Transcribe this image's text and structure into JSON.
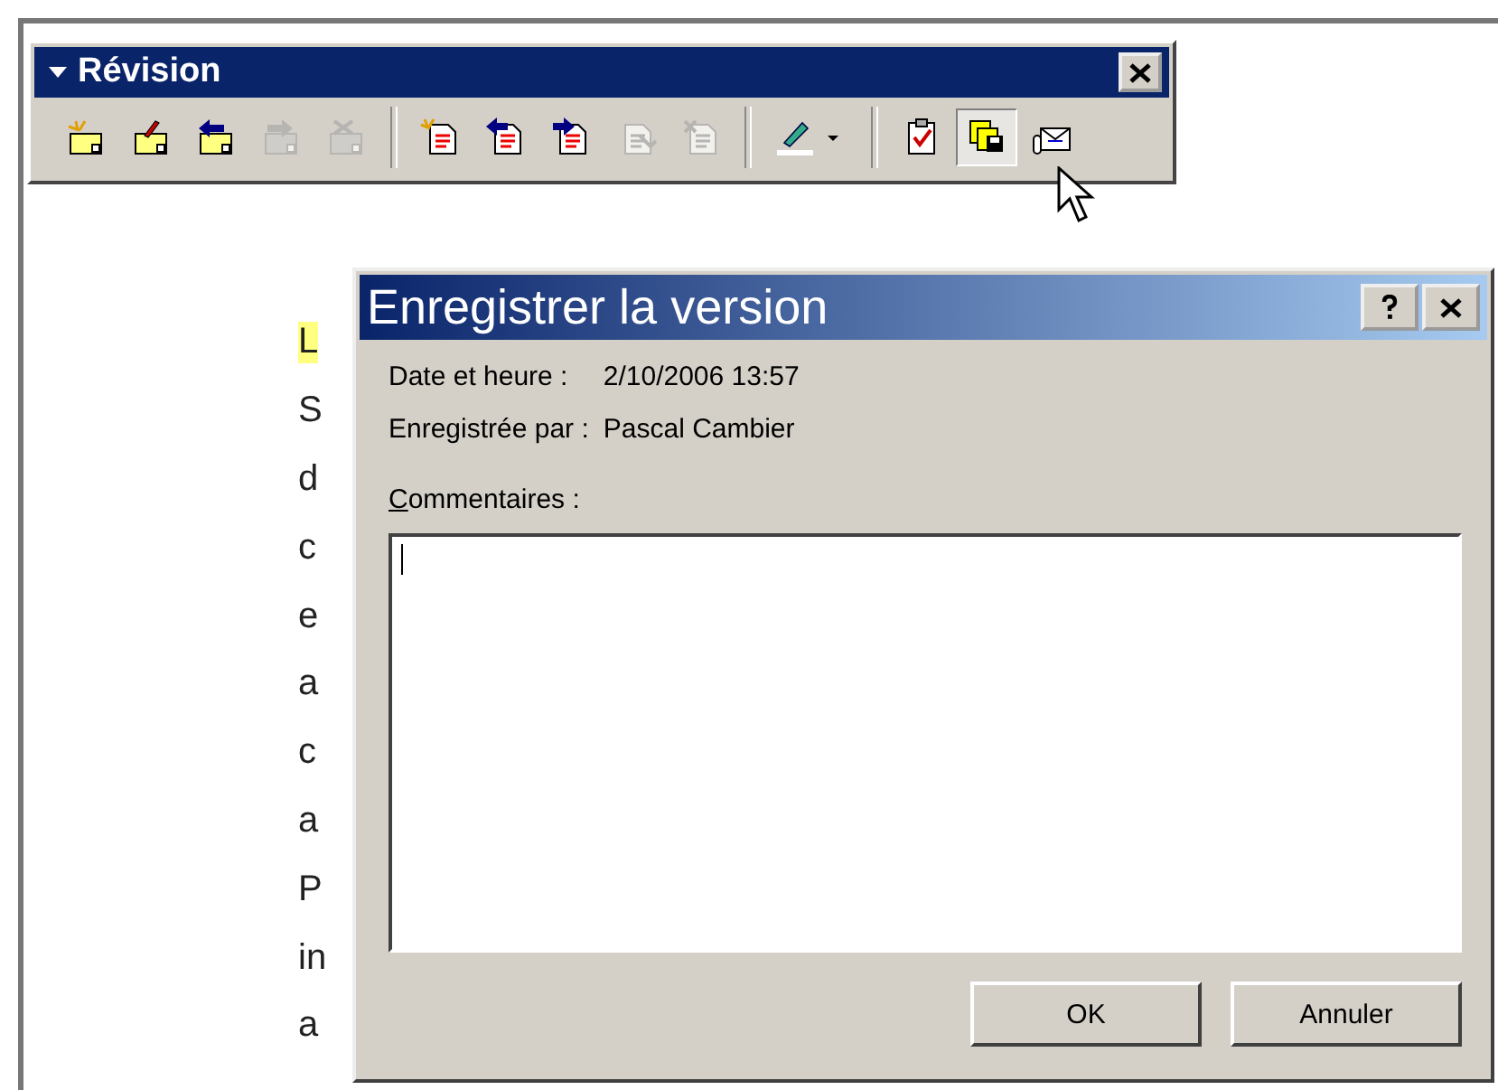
{
  "document": {
    "rows": [
      {
        "text": "L",
        "highlighted": true
      },
      {
        "text": "S",
        "highlighted": false
      },
      {
        "text": "d",
        "highlighted": false
      },
      {
        "text": "c",
        "highlighted": false
      },
      {
        "text": "e",
        "highlighted": false
      },
      {
        "text": "a",
        "highlighted": false
      },
      {
        "text": "c",
        "highlighted": false
      },
      {
        "text": "a",
        "highlighted": false
      },
      {
        "text": "P",
        "highlighted": false
      },
      {
        "text": "in",
        "highlighted": false
      },
      {
        "text": "a",
        "highlighted": false
      }
    ]
  },
  "toolbar": {
    "title": "Révision",
    "buttons": [
      {
        "kind": "note-new",
        "disabled": false,
        "pressed": false
      },
      {
        "kind": "note-edit",
        "disabled": false,
        "pressed": false
      },
      {
        "kind": "note-prev",
        "disabled": false,
        "pressed": false
      },
      {
        "kind": "note-next",
        "disabled": true,
        "pressed": false
      },
      {
        "kind": "note-delete",
        "disabled": true,
        "pressed": false
      },
      {
        "kind": "separator"
      },
      {
        "kind": "change-new",
        "disabled": false,
        "pressed": false
      },
      {
        "kind": "change-prev",
        "disabled": false,
        "pressed": false
      },
      {
        "kind": "change-next",
        "disabled": false,
        "pressed": false
      },
      {
        "kind": "change-accept",
        "disabled": true,
        "pressed": false
      },
      {
        "kind": "change-reject",
        "disabled": true,
        "pressed": false
      },
      {
        "kind": "separator"
      },
      {
        "kind": "highlight",
        "disabled": false,
        "pressed": false
      },
      {
        "kind": "separator"
      },
      {
        "kind": "review-pane",
        "disabled": false,
        "pressed": false
      },
      {
        "kind": "versions",
        "disabled": false,
        "pressed": true
      },
      {
        "kind": "send",
        "disabled": false,
        "pressed": false
      }
    ]
  },
  "dialog": {
    "title": "Enregistrer la version",
    "fields": [
      {
        "label": "Date et heure :",
        "value": "2/10/2006 13:57"
      },
      {
        "label": "Enregistrée par :",
        "value": "Pascal Cambier"
      }
    ],
    "comments_label": "Commentaires :",
    "buttons": [
      "OK",
      "Annuler"
    ]
  }
}
